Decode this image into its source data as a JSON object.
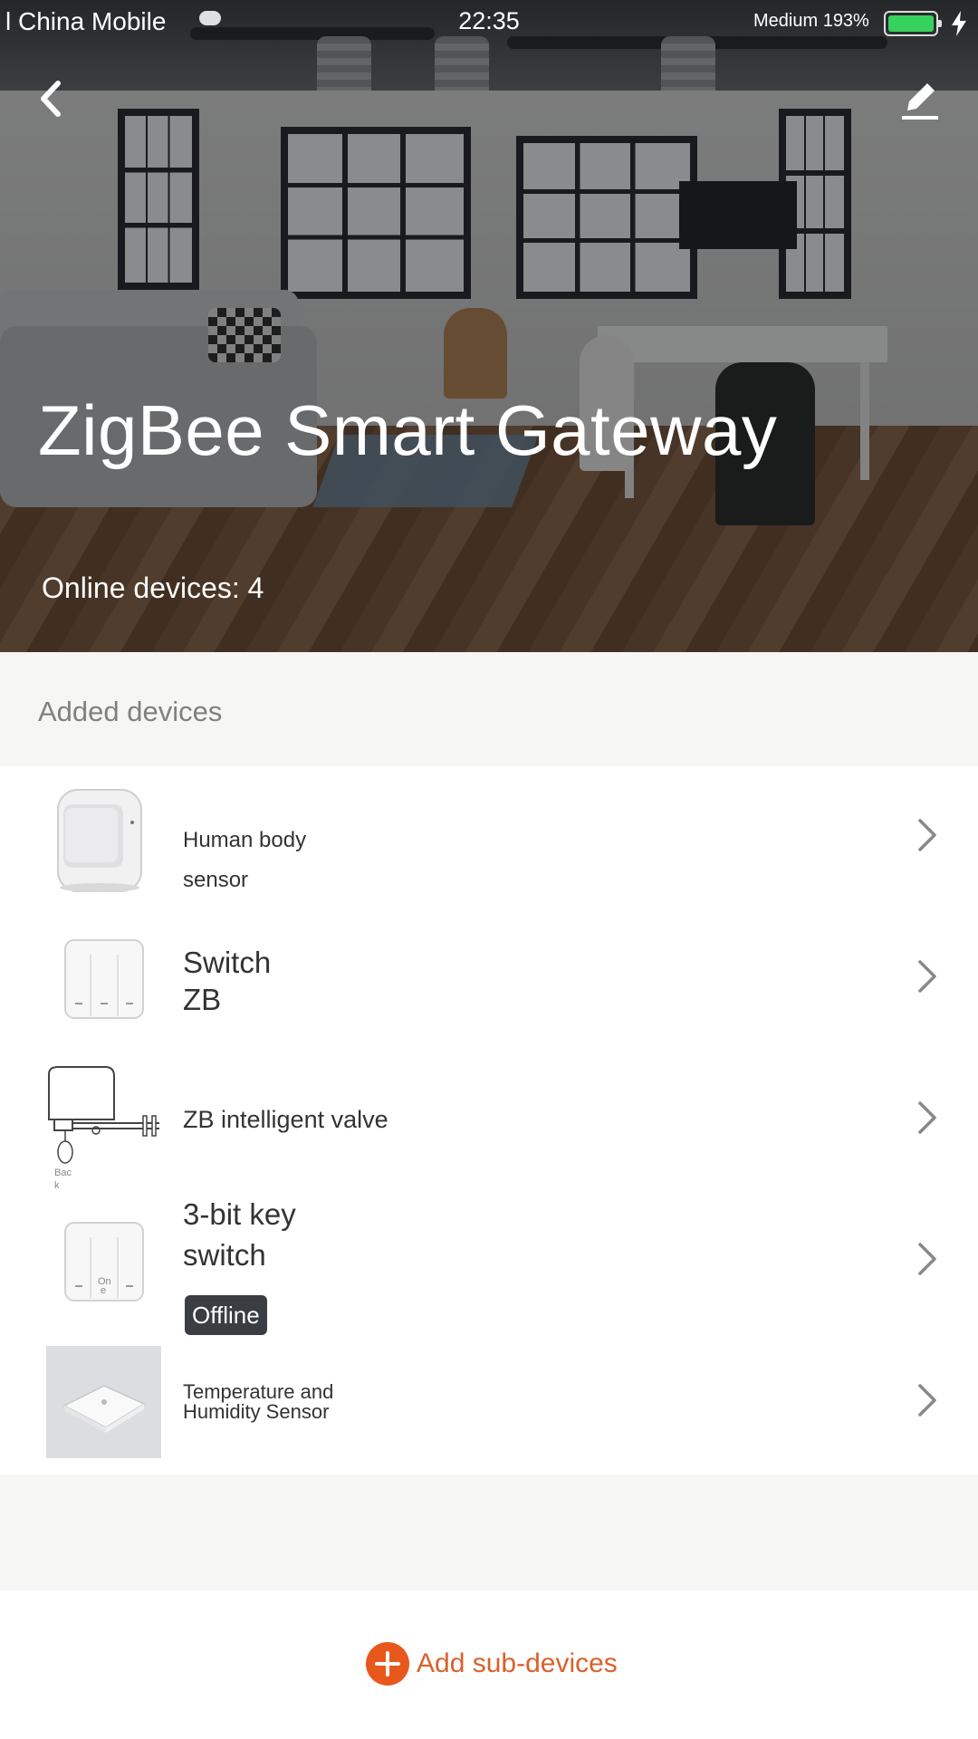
{
  "status_bar": {
    "carrier": "l China Mobile",
    "time": "22:35",
    "network": "Medium 193%",
    "battery_color": "#35d35e"
  },
  "hero": {
    "title": "ZigBee Smart Gateway",
    "online_label": "Online devices: 4",
    "back_icon": "chevron-left-icon",
    "edit_icon": "pencil-icon"
  },
  "section": {
    "title": "Added devices"
  },
  "devices": [
    {
      "name_line1": "Human body",
      "name_line2": "sensor",
      "icon": "motion-sensor-icon",
      "status": ""
    },
    {
      "name_line1": "Switch",
      "name_line2": "ZB",
      "icon": "three-gang-switch-icon",
      "status": ""
    },
    {
      "name_line1": "ZB intelligent valve",
      "name_line2": "",
      "icon": "valve-actuator-icon",
      "icon_text": "Bac k",
      "status": ""
    },
    {
      "name_line1": "3-bit key",
      "name_line2": "switch",
      "icon": "key-switch-icon",
      "icon_text": "On e",
      "status": "Offline"
    },
    {
      "name_line1": "Temperature and",
      "name_line2": "Humidity Sensor",
      "icon": "temp-humidity-sensor-icon",
      "status": ""
    }
  ],
  "footer": {
    "add_label": "Add sub-devices",
    "accent": "#e8581c"
  }
}
